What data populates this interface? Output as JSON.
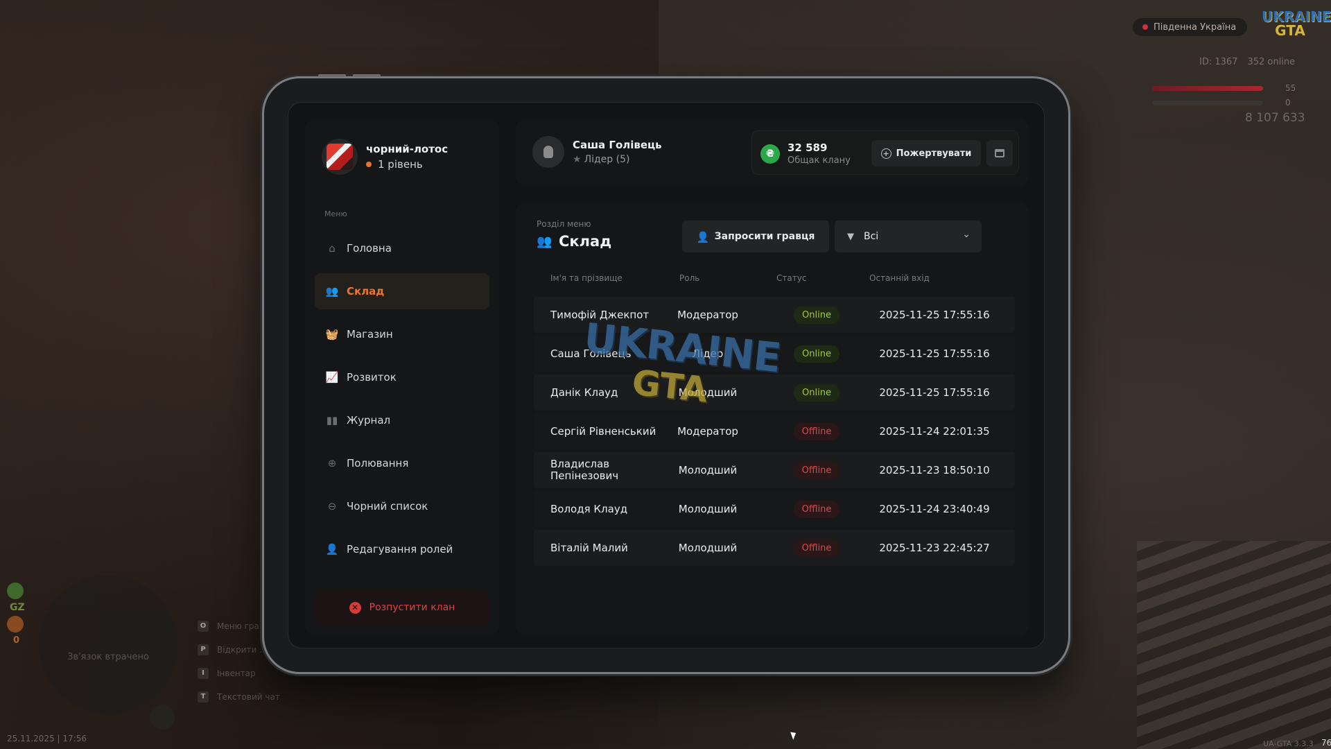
{
  "hud": {
    "server": "Південна Україна",
    "logo_top": "UKRAINE",
    "logo_bottom": "GTA",
    "player_id": "ID: 1367",
    "online": "352 online",
    "health": "55",
    "armor": "0",
    "money": "8 107 633",
    "gz": "GZ",
    "wanted": "0",
    "radar_text": "Зв'язок втрачено",
    "hints": [
      {
        "key": "O",
        "label": "Меню гравця"
      },
      {
        "key": "P",
        "label": "Відкрити ..."
      },
      {
        "key": "I",
        "label": "Інвентар"
      },
      {
        "key": "T",
        "label": "Текстовий чат"
      }
    ],
    "datetime": "25.11.2025 | 17:56",
    "version": "UA-GTA 3.3.3",
    "fps": "76"
  },
  "clan": {
    "name": "чорний-лотос",
    "level": "1 рівень"
  },
  "sidebar": {
    "menu_caption": "Меню",
    "items": [
      {
        "label": "Головна",
        "icon": "home-icon"
      },
      {
        "label": "Склад",
        "icon": "members-icon",
        "active": true
      },
      {
        "label": "Магазин",
        "icon": "shop-basket-icon"
      },
      {
        "label": "Розвиток",
        "icon": "chart-icon"
      },
      {
        "label": "Журнал",
        "icon": "book-icon"
      },
      {
        "label": "Полювання",
        "icon": "crosshair-icon"
      },
      {
        "label": "Чорний список",
        "icon": "block-icon"
      },
      {
        "label": "Редагування ролей",
        "icon": "user-edit-icon"
      }
    ],
    "disband_label": "Розпустити клан"
  },
  "user": {
    "name": "Саша Голівець",
    "role": "Лідер (5)"
  },
  "treasury": {
    "value": "32 589",
    "label": "Общак клану",
    "donate_label": "Пожертвувати",
    "coin_symbol": "₴"
  },
  "section": {
    "caption": "Розділ меню",
    "title": "Склад",
    "invite_label": "Запросити гравця",
    "filter_value": "Всі"
  },
  "table": {
    "headers": {
      "name": "Ім'я та прізвище",
      "role": "Роль",
      "status": "Статус",
      "last_login": "Останній вхід"
    },
    "rows": [
      {
        "name": "Тимофій Джекпот",
        "role": "Модератор",
        "status": "Online",
        "date": "2025-11-25 17:55:16"
      },
      {
        "name": "Саша Голівець",
        "role": "Лідер",
        "status": "Online",
        "date": "2025-11-25 17:55:16"
      },
      {
        "name": "Данік Клауд",
        "role": "Молодший",
        "status": "Online",
        "date": "2025-11-25 17:55:16"
      },
      {
        "name": "Сергій Рівненський",
        "role": "Модератор",
        "status": "Offline",
        "date": "2025-11-24 22:01:35"
      },
      {
        "name": "Владислав Пепінезович",
        "role": "Молодший",
        "status": "Offline",
        "date": "2025-11-23 18:50:10"
      },
      {
        "name": "Володя Клауд",
        "role": "Молодший",
        "status": "Offline",
        "date": "2025-11-24 23:40:49"
      },
      {
        "name": "Віталій Малий",
        "role": "Молодший",
        "status": "Offline",
        "date": "2025-11-23 22:45:27"
      }
    ]
  },
  "colors": {
    "accent": "#e8772c",
    "online": "#9ecf2e",
    "offline": "#d84a4a",
    "coin": "#2ca84b",
    "danger": "#d63b3b"
  }
}
